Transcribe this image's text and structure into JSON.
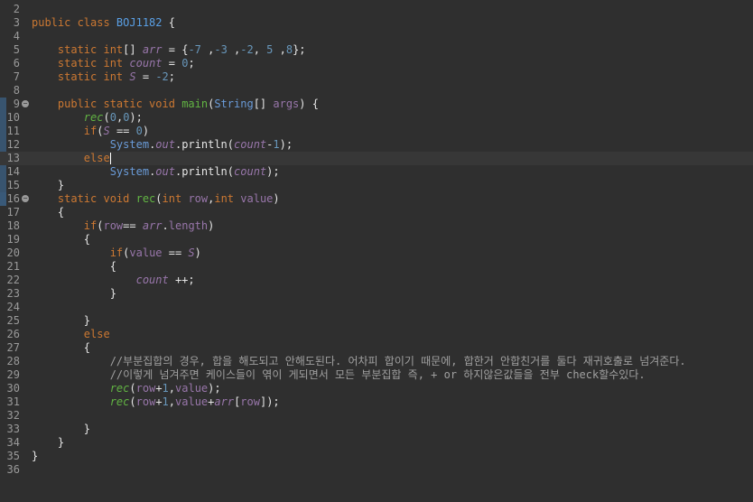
{
  "editor": {
    "line_numbers": [
      "2",
      "3",
      "4",
      "5",
      "6",
      "7",
      "8",
      "9",
      "10",
      "11",
      "12",
      "13",
      "14",
      "15",
      "16",
      "17",
      "18",
      "19",
      "20",
      "21",
      "22",
      "23",
      "24",
      "25",
      "26",
      "27",
      "28",
      "29",
      "30",
      "31",
      "32",
      "33",
      "34",
      "35",
      "36"
    ],
    "lines": [
      [],
      [
        {
          "t": "public class ",
          "c": "kw"
        },
        {
          "t": "BOJ1182",
          "c": "cls"
        },
        {
          "t": " {"
        }
      ],
      [],
      [
        {
          "t": "    "
        },
        {
          "t": "static int",
          "c": "kw"
        },
        {
          "t": "[] "
        },
        {
          "t": "arr",
          "c": "fld it"
        },
        {
          "t": " = {"
        },
        {
          "t": "-7",
          "c": "num"
        },
        {
          "t": " ,"
        },
        {
          "t": "-3",
          "c": "num"
        },
        {
          "t": " ,"
        },
        {
          "t": "-2",
          "c": "num"
        },
        {
          "t": ", "
        },
        {
          "t": "5",
          "c": "num"
        },
        {
          "t": " ,"
        },
        {
          "t": "8",
          "c": "num"
        },
        {
          "t": "};"
        }
      ],
      [
        {
          "t": "    "
        },
        {
          "t": "static int ",
          "c": "kw"
        },
        {
          "t": "count",
          "c": "fld it"
        },
        {
          "t": " = "
        },
        {
          "t": "0",
          "c": "num"
        },
        {
          "t": ";"
        }
      ],
      [
        {
          "t": "    "
        },
        {
          "t": "static int ",
          "c": "kw"
        },
        {
          "t": "S",
          "c": "fld it"
        },
        {
          "t": " = "
        },
        {
          "t": "-2",
          "c": "num"
        },
        {
          "t": ";"
        }
      ],
      [],
      [
        {
          "t": "    "
        },
        {
          "t": "public static void ",
          "c": "kw"
        },
        {
          "t": "main",
          "c": "meth"
        },
        {
          "t": "("
        },
        {
          "t": "String",
          "c": "typ"
        },
        {
          "t": "[] "
        },
        {
          "t": "args",
          "c": "fld"
        },
        {
          "t": ") {"
        }
      ],
      [
        {
          "t": "        "
        },
        {
          "t": "rec",
          "c": "meth it"
        },
        {
          "t": "("
        },
        {
          "t": "0",
          "c": "num"
        },
        {
          "t": ","
        },
        {
          "t": "0",
          "c": "num"
        },
        {
          "t": ");"
        }
      ],
      [
        {
          "t": "        "
        },
        {
          "t": "if",
          "c": "kw"
        },
        {
          "t": "("
        },
        {
          "t": "S",
          "c": "fld it"
        },
        {
          "t": " == "
        },
        {
          "t": "0",
          "c": "num"
        },
        {
          "t": ")"
        }
      ],
      [
        {
          "t": "            "
        },
        {
          "t": "System",
          "c": "typ"
        },
        {
          "t": "."
        },
        {
          "t": "out",
          "c": "fld it"
        },
        {
          "t": ".println("
        },
        {
          "t": "count",
          "c": "fld it"
        },
        {
          "t": "-"
        },
        {
          "t": "1",
          "c": "num"
        },
        {
          "t": ");"
        }
      ],
      [
        {
          "t": "        "
        },
        {
          "t": "else",
          "c": "kw"
        }
      ],
      [
        {
          "t": "            "
        },
        {
          "t": "System",
          "c": "typ"
        },
        {
          "t": "."
        },
        {
          "t": "out",
          "c": "fld it"
        },
        {
          "t": ".println("
        },
        {
          "t": "count",
          "c": "fld it"
        },
        {
          "t": ");"
        }
      ],
      [
        {
          "t": "    }"
        }
      ],
      [
        {
          "t": "    "
        },
        {
          "t": "static void ",
          "c": "kw"
        },
        {
          "t": "rec",
          "c": "meth"
        },
        {
          "t": "("
        },
        {
          "t": "int ",
          "c": "kw"
        },
        {
          "t": "row",
          "c": "fld"
        },
        {
          "t": ","
        },
        {
          "t": "int ",
          "c": "kw"
        },
        {
          "t": "value",
          "c": "fld"
        },
        {
          "t": ")"
        }
      ],
      [
        {
          "t": "    {"
        }
      ],
      [
        {
          "t": "        "
        },
        {
          "t": "if",
          "c": "kw"
        },
        {
          "t": "("
        },
        {
          "t": "row",
          "c": "fld"
        },
        {
          "t": "== "
        },
        {
          "t": "arr",
          "c": "fld it"
        },
        {
          "t": "."
        },
        {
          "t": "length",
          "c": "fld"
        },
        {
          "t": ")"
        }
      ],
      [
        {
          "t": "        {"
        }
      ],
      [
        {
          "t": "            "
        },
        {
          "t": "if",
          "c": "kw"
        },
        {
          "t": "("
        },
        {
          "t": "value",
          "c": "fld"
        },
        {
          "t": " == "
        },
        {
          "t": "S",
          "c": "fld it"
        },
        {
          "t": ")"
        }
      ],
      [
        {
          "t": "            {"
        }
      ],
      [
        {
          "t": "                "
        },
        {
          "t": "count",
          "c": "fld it"
        },
        {
          "t": " ++;"
        }
      ],
      [
        {
          "t": "            }"
        }
      ],
      [],
      [
        {
          "t": "        }"
        }
      ],
      [
        {
          "t": "        "
        },
        {
          "t": "else",
          "c": "kw"
        }
      ],
      [
        {
          "t": "        {"
        }
      ],
      [
        {
          "t": "            "
        },
        {
          "t": "//부분집합의 경우, 합을 해도되고 안해도된다. 어차피 합이기 때문에, 합한거 안합친거를 둘다 재귀호출로 넘겨준다.",
          "c": "cmt"
        }
      ],
      [
        {
          "t": "            "
        },
        {
          "t": "//이렇게 넘겨주면 케이스들이 엮이 게되면서 모든 부분집합 즉, + or 하지않은값들을 전부 check할수있다.",
          "c": "cmt"
        }
      ],
      [
        {
          "t": "            "
        },
        {
          "t": "rec",
          "c": "meth it"
        },
        {
          "t": "("
        },
        {
          "t": "row",
          "c": "fld"
        },
        {
          "t": "+"
        },
        {
          "t": "1",
          "c": "num"
        },
        {
          "t": ","
        },
        {
          "t": "value",
          "c": "fld"
        },
        {
          "t": ");"
        }
      ],
      [
        {
          "t": "            "
        },
        {
          "t": "rec",
          "c": "meth it"
        },
        {
          "t": "("
        },
        {
          "t": "row",
          "c": "fld"
        },
        {
          "t": "+"
        },
        {
          "t": "1",
          "c": "num"
        },
        {
          "t": ","
        },
        {
          "t": "value",
          "c": "fld"
        },
        {
          "t": "+"
        },
        {
          "t": "arr",
          "c": "fld it"
        },
        {
          "t": "["
        },
        {
          "t": "row",
          "c": "fld"
        },
        {
          "t": "]);"
        }
      ],
      [],
      [
        {
          "t": "        }"
        }
      ],
      [
        {
          "t": "    }"
        }
      ],
      [
        {
          "t": "}"
        }
      ],
      []
    ]
  }
}
